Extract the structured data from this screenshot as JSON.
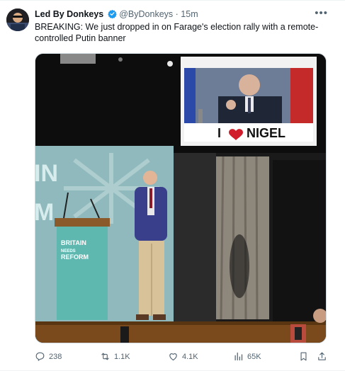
{
  "author": {
    "name": "Led By Donkeys",
    "handle": "@ByDonkeys",
    "separator": "·",
    "time": "15m"
  },
  "tweet": {
    "text": "BREAKING: We just dropped in on Farage's election rally with a remote-controlled Putin banner"
  },
  "image": {
    "banner_text_prefix": "I",
    "banner_text_name": "NIGEL",
    "lectern_line1": "BRITAIN",
    "lectern_line2": "NEEDS",
    "lectern_line3": "REFORM",
    "backdrop_text_1": "IN",
    "backdrop_text_2": "M"
  },
  "metrics": {
    "replies": "238",
    "reposts": "1.1K",
    "likes": "4.1K",
    "views": "65K"
  },
  "colors": {
    "verified": "#1d9bf0",
    "secondary_text": "#536471",
    "reform_teal": "#5fb8b0"
  }
}
